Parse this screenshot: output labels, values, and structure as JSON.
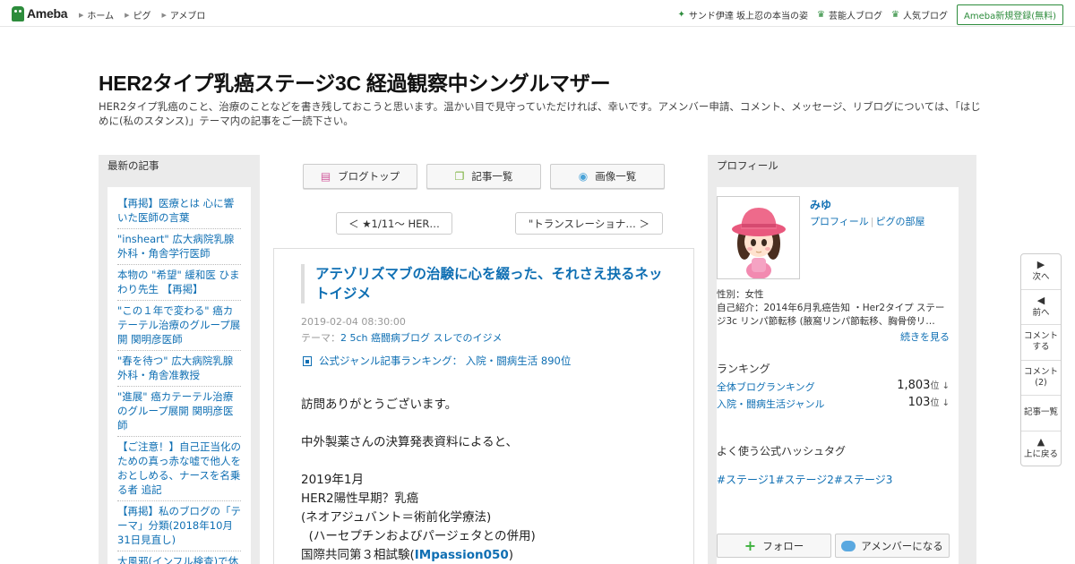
{
  "topbar": {
    "logo": "Ameba",
    "nav": [
      "ホーム",
      "ピグ",
      "アメブロ"
    ],
    "right_links": [
      {
        "icon": "star-icon",
        "label": "サンド伊達 坂上忍の本当の姿"
      },
      {
        "icon": "crown-icon",
        "label": "芸能人ブログ"
      },
      {
        "icon": "crown-icon",
        "label": "人気ブログ"
      }
    ],
    "signup": "Ameba新規登録(無料)"
  },
  "header": {
    "title": "HER2タイプ乳癌ステージ3C 経過観察中シングルマザー",
    "description": "HER2タイプ乳癌のこと、治療のことなどを書き残しておこうと思います。温かい目で見守っていただければ、幸いです。アメンバー申請、コメント、メッセージ、リブログについては、「はじめに(私のスタンス)」テーマ内の記事をご一読下さい。"
  },
  "left_sidebar": {
    "heading": "最新の記事",
    "items": [
      "【再掲】医療とは 心に響いた医師の言葉",
      "\"insheart\" 広大病院乳腺外科・角舎学行医師",
      "本物の \"希望\" 緩和医 ひまわり先生 【再掲】",
      "\"この１年で変わる\" 癌カテーテル治療のグループ展開 関明彦医師",
      "\"春を待つ\" 広大病院乳腺外科・角舎准教授",
      "\"進展\" 癌カテーテル治療のグループ展開 関明彦医師",
      "【ご注意！】自己正当化のための真っ赤な嘘で他人をおとしめる、ナースを名乗る者 追記",
      "【再掲】私のブログの「テーマ」分類(2018年10月31日見直し)",
      "大風邪(インフル検査)で休"
    ]
  },
  "center": {
    "buttons": [
      {
        "icon": "document-icon",
        "label": "ブログトップ"
      },
      {
        "icon": "copy-icon",
        "label": "記事一覧"
      },
      {
        "icon": "camera-icon",
        "label": "画像一覧"
      }
    ],
    "prev": "＜ ★1/11～ HER…",
    "next": "\"トランスレーショナ… ＞",
    "entry": {
      "title": "アテゾリズマブの治験に心を綴った、それさえ抉るネットイジメ",
      "date": "2019-02-04 08:30:00",
      "theme_label": "テーマ：",
      "theme": "2 5ch 癌闘病ブログ スレでのイジメ",
      "ranking": "公式ジャンル記事ランキング：  入院・闘病生活   890位",
      "body_lines": [
        "訪問ありがとうございます。",
        "",
        "中外製薬さんの決算発表資料によると、",
        "",
        "2019年1月",
        "HER2陽性早期？乳癌",
        "(ネオアジュバント＝術前化学療法)",
        "  (ハーセプチンおよびパージェタとの併用)"
      ],
      "body_last_prefix": "国際共同第３相試験(",
      "body_last_highlight": "IMpassion050",
      "body_last_suffix": ")"
    }
  },
  "right_sidebar": {
    "heading": "プロフィール",
    "name": "みゆ",
    "link_profile": "プロフィール",
    "link_pig": "ピグの部屋",
    "gender": "性別：女性",
    "intro": "自己紹介：2014年6月乳癌告知 ・Her2タイプ ステージ3c リンパ節転移 (腋窩リンパ節転移、胸骨傍リ…",
    "more": "続きを見る",
    "ranking_heading": "ランキング",
    "rankings": [
      {
        "label": "全体ブログランキング",
        "value": "1,803",
        "unit": "位 ↓"
      },
      {
        "label": "入院・闘病生活ジャンル",
        "value": "103",
        "unit": "位 ↓"
      }
    ],
    "hashtag_heading": "よく使う公式ハッシュタグ",
    "hashtags": [
      "#ステージ1",
      "#ステージ2",
      "#ステージ3"
    ],
    "follow": "フォロー",
    "amember": "アメンバーになる"
  },
  "floating": [
    {
      "icon": "▶",
      "label": "次へ"
    },
    {
      "icon": "◀",
      "label": "前へ"
    },
    {
      "icon": "",
      "label": "コメント\nする"
    },
    {
      "icon": "",
      "label": "コメント\n(2)"
    },
    {
      "icon": "",
      "label": "記事一覧"
    },
    {
      "icon": "▲",
      "label": "上に戻る"
    }
  ],
  "colors": {
    "link": "#0f6fb3",
    "brand": "#2d8c3c",
    "sidebar_bg": "#ebebeb"
  }
}
